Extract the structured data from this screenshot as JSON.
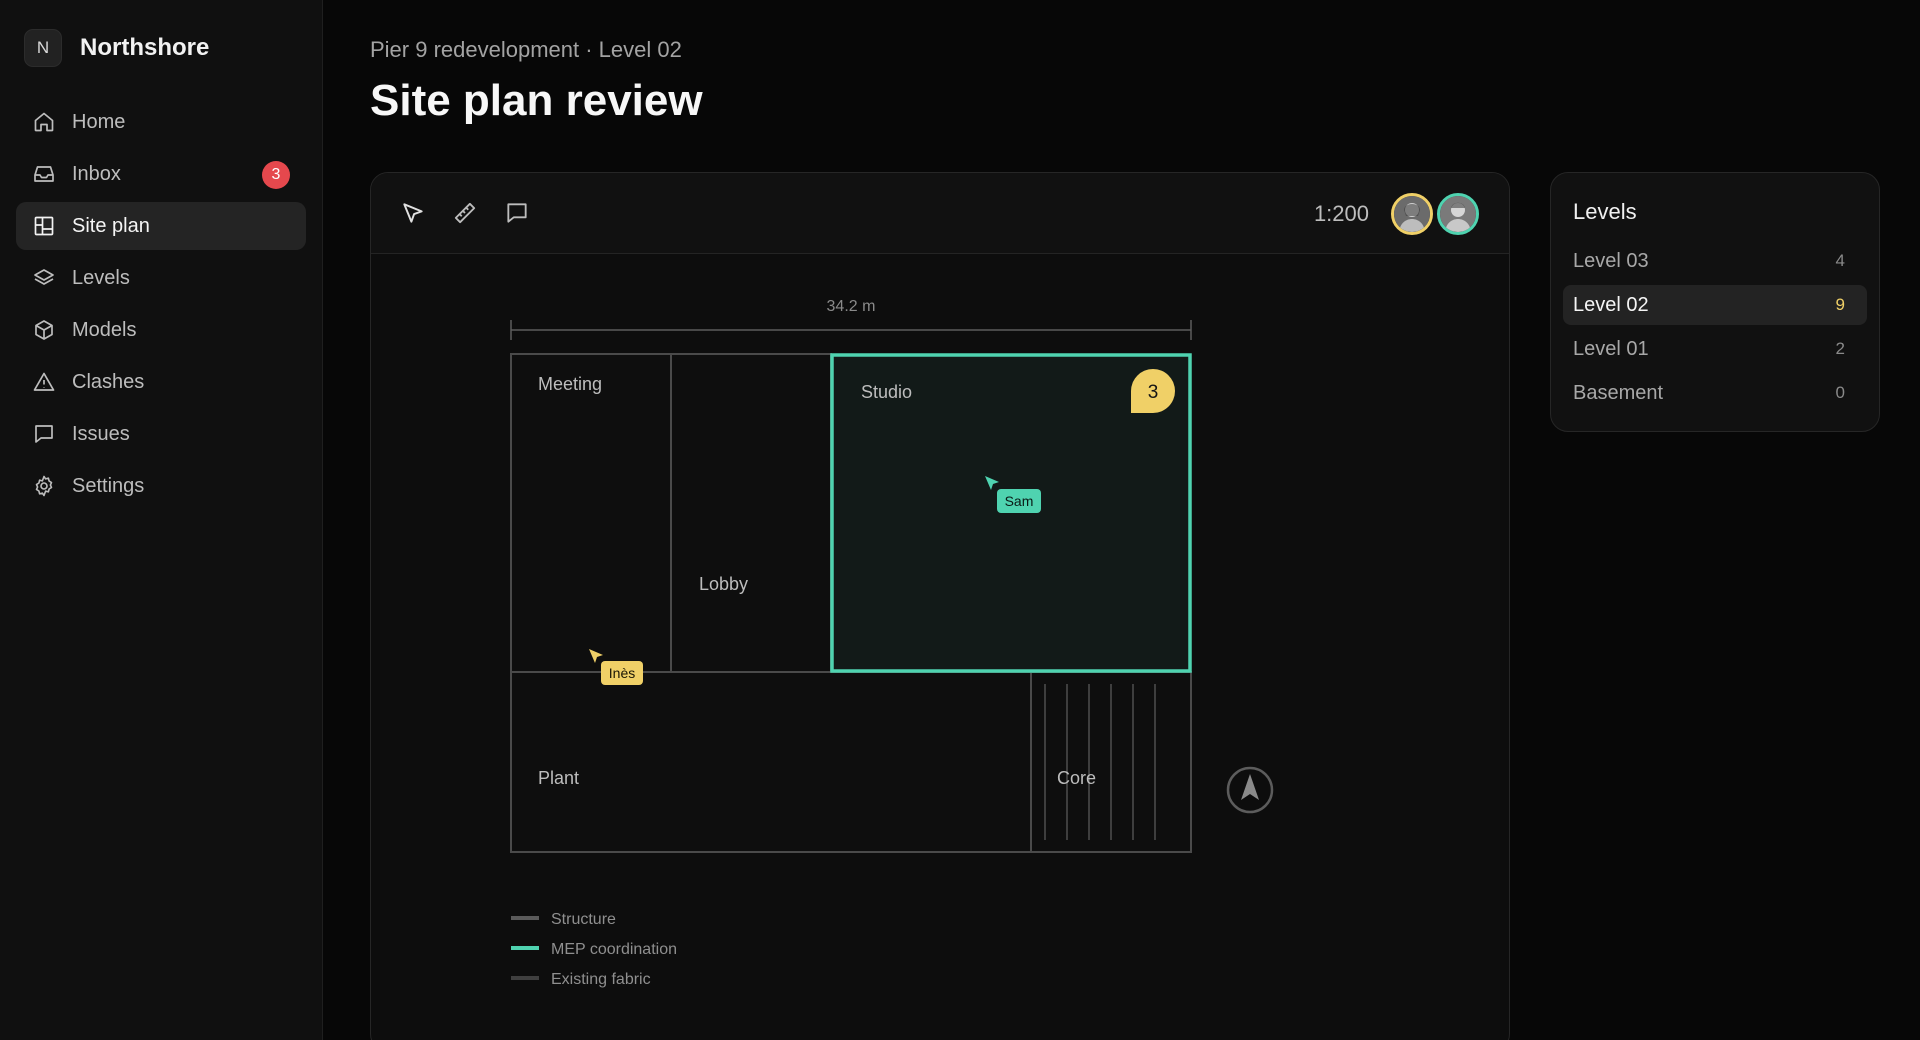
{
  "brand": {
    "initial": "N",
    "name": "Northshore"
  },
  "nav": {
    "items": [
      {
        "id": "home",
        "label": "Home",
        "icon": "home-icon"
      },
      {
        "id": "inbox",
        "label": "Inbox",
        "icon": "inbox-icon",
        "badge": "3"
      },
      {
        "id": "site-plan",
        "label": "Site plan",
        "icon": "layout-icon",
        "active": true
      },
      {
        "id": "levels",
        "label": "Levels",
        "icon": "layers-icon"
      },
      {
        "id": "models",
        "label": "Models",
        "icon": "cube-icon"
      },
      {
        "id": "clashes",
        "label": "Clashes",
        "icon": "warning-icon"
      },
      {
        "id": "issues",
        "label": "Issues",
        "icon": "chat-icon"
      },
      {
        "id": "settings",
        "label": "Settings",
        "icon": "gear-icon"
      }
    ]
  },
  "header": {
    "breadcrumb": "Pier 9 redevelopment · Level 02",
    "title": "Site plan review"
  },
  "toolbar": {
    "tools": [
      "pointer-icon",
      "ruler-icon",
      "comment-icon"
    ],
    "scale": "1:200"
  },
  "plan": {
    "dimension": "34.2 m",
    "rooms": {
      "meeting": "Meeting",
      "lobby": "Lobby",
      "studio": "Studio",
      "plant": "Plant",
      "core": "Core"
    },
    "studio_comment_count": "3",
    "cursors": {
      "sam": "Sam",
      "ines": "Inès"
    },
    "legend": [
      {
        "label": "Structure",
        "color": "#5a5a5a"
      },
      {
        "label": "MEP coordination",
        "color": "#4fd3b0"
      },
      {
        "label": "Existing fabric",
        "color": "#3f3f3f"
      }
    ]
  },
  "colors": {
    "accent_teal": "#4fd3b0",
    "accent_yellow": "#f0d067",
    "badge_red": "#e5484d"
  },
  "levels": {
    "title": "Levels",
    "items": [
      {
        "name": "Level 03",
        "count": "4"
      },
      {
        "name": "Level 02",
        "count": "9",
        "active": true
      },
      {
        "name": "Level 01",
        "count": "2"
      },
      {
        "name": "Basement",
        "count": "0"
      }
    ]
  }
}
